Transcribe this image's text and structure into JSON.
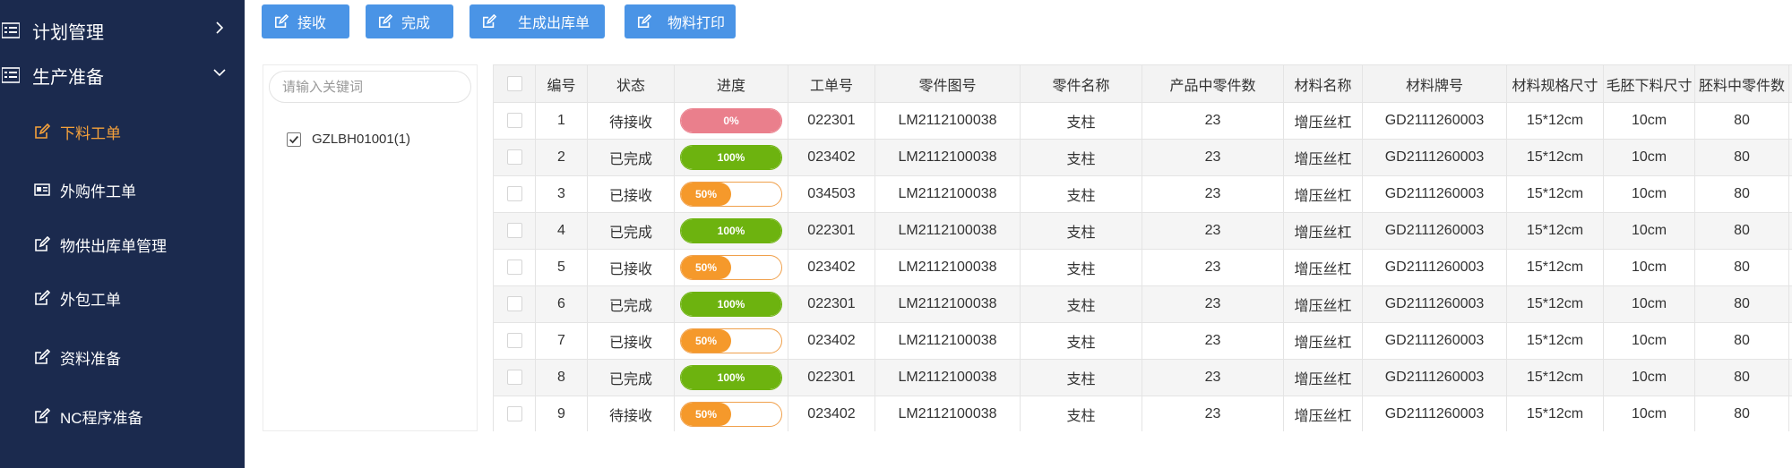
{
  "sidebar": {
    "groups": [
      {
        "label": "计划管理",
        "icon": "list-icon",
        "chevron": "chevron-right-icon"
      },
      {
        "label": "生产准备",
        "icon": "list-icon",
        "chevron": "chevron-down-icon"
      }
    ],
    "items": [
      {
        "label": "下料工单",
        "icon": "edit-icon",
        "active": true
      },
      {
        "label": "外购件工单",
        "icon": "card-icon",
        "active": false
      },
      {
        "label": "物供出库单管理",
        "icon": "edit-icon",
        "active": false
      },
      {
        "label": "外包工单",
        "icon": "edit-icon",
        "active": false
      },
      {
        "label": "资料准备",
        "icon": "edit-icon",
        "active": false
      },
      {
        "label": "NC程序准备",
        "icon": "edit-icon",
        "active": false
      }
    ]
  },
  "toolbar": {
    "buttons": [
      {
        "label": "接收",
        "icon": "edit-icon"
      },
      {
        "label": "完成",
        "icon": "edit-icon"
      },
      {
        "label": "生成出库单",
        "icon": "edit-icon"
      },
      {
        "label": "物料打印",
        "icon": "edit-icon"
      }
    ]
  },
  "search": {
    "placeholder": "请输入关键词",
    "value": "",
    "tree": [
      {
        "label": "GZLBH01001(1)",
        "checked": true
      }
    ]
  },
  "table": {
    "headers": [
      "编号",
      "状态",
      "进度",
      "工单号",
      "零件图号",
      "零件名称",
      "产品中零件数",
      "材料名称",
      "材料牌号",
      "材料规格尺寸",
      "毛胚下料尺寸",
      "胚料中零件数"
    ],
    "rows": [
      {
        "no": "1",
        "status": "待接收",
        "progress": 0,
        "progress_label": "0%",
        "order": "022301",
        "drawing": "LM2112100038",
        "part": "支柱",
        "count": "23",
        "material": "增压丝杠",
        "grade": "GD2111260003",
        "spec": "15*12cm",
        "blank": "10cm",
        "per_blank": "80"
      },
      {
        "no": "2",
        "status": "已完成",
        "progress": 100,
        "progress_label": "100%",
        "order": "023402",
        "drawing": "LM2112100038",
        "part": "支柱",
        "count": "23",
        "material": "增压丝杠",
        "grade": "GD2111260003",
        "spec": "15*12cm",
        "blank": "10cm",
        "per_blank": "80"
      },
      {
        "no": "3",
        "status": "已接收",
        "progress": 50,
        "progress_label": "50%",
        "order": "034503",
        "drawing": "LM2112100038",
        "part": "支柱",
        "count": "23",
        "material": "增压丝杠",
        "grade": "GD2111260003",
        "spec": "15*12cm",
        "blank": "10cm",
        "per_blank": "80"
      },
      {
        "no": "4",
        "status": "已完成",
        "progress": 100,
        "progress_label": "100%",
        "order": "022301",
        "drawing": "LM2112100038",
        "part": "支柱",
        "count": "23",
        "material": "增压丝杠",
        "grade": "GD2111260003",
        "spec": "15*12cm",
        "blank": "10cm",
        "per_blank": "80"
      },
      {
        "no": "5",
        "status": "已接收",
        "progress": 50,
        "progress_label": "50%",
        "order": "023402",
        "drawing": "LM2112100038",
        "part": "支柱",
        "count": "23",
        "material": "增压丝杠",
        "grade": "GD2111260003",
        "spec": "15*12cm",
        "blank": "10cm",
        "per_blank": "80"
      },
      {
        "no": "6",
        "status": "已完成",
        "progress": 100,
        "progress_label": "100%",
        "order": "022301",
        "drawing": "LM2112100038",
        "part": "支柱",
        "count": "23",
        "material": "增压丝杠",
        "grade": "GD2111260003",
        "spec": "15*12cm",
        "blank": "10cm",
        "per_blank": "80"
      },
      {
        "no": "7",
        "status": "已接收",
        "progress": 50,
        "progress_label": "50%",
        "order": "023402",
        "drawing": "LM2112100038",
        "part": "支柱",
        "count": "23",
        "material": "增压丝杠",
        "grade": "GD2111260003",
        "spec": "15*12cm",
        "blank": "10cm",
        "per_blank": "80"
      },
      {
        "no": "8",
        "status": "已完成",
        "progress": 100,
        "progress_label": "100%",
        "order": "022301",
        "drawing": "LM2112100038",
        "part": "支柱",
        "count": "23",
        "material": "增压丝杠",
        "grade": "GD2111260003",
        "spec": "15*12cm",
        "blank": "10cm",
        "per_blank": "80"
      },
      {
        "no": "9",
        "status": "待接收",
        "progress": 50,
        "progress_label": "50%",
        "order": "023402",
        "drawing": "LM2112100038",
        "part": "支柱",
        "count": "23",
        "material": "增压丝杠",
        "grade": "GD2111260003",
        "spec": "15*12cm",
        "blank": "10cm",
        "per_blank": "80"
      }
    ]
  },
  "colors": {
    "sidebar_bg": "#1b2a4e",
    "active_item": "#f5a13b",
    "button_bg": "#4a94e6",
    "progress_zero": "#ea7f8c",
    "progress_full": "#6db30f",
    "progress_half": "#f5992b"
  }
}
